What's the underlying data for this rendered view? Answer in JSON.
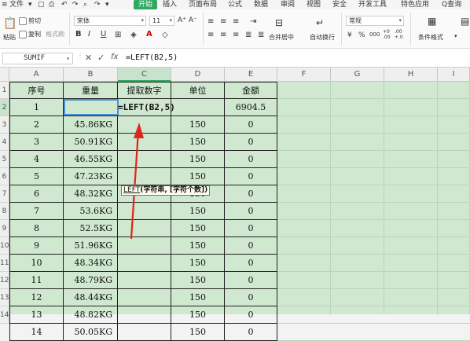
{
  "menu": {
    "file": "文件",
    "items": [
      "开始",
      "插入",
      "页面布局",
      "公式",
      "数据",
      "审阅",
      "视图",
      "安全",
      "开发工具",
      "特色应用"
    ],
    "search": "Q查询"
  },
  "ribbon": {
    "cut": "剪切",
    "paste": "粘贴",
    "copy": "复制",
    "format_painter": "格式刷",
    "font_name": "宋体",
    "font_size": "11",
    "bold": "B",
    "italic": "I",
    "underline": "U",
    "merge_center": "合并居中",
    "wrap_text": "自动换行",
    "number_format": "常规",
    "currency": "¥",
    "percent": "%",
    "thousands": "000",
    "dec_inc": "+0 .00",
    "dec_dec": ".00 +.0",
    "conditional_format": "条件格式"
  },
  "formula_bar": {
    "name_box": "SUMIF",
    "cancel": "✕",
    "confirm": "✓",
    "fx": "fx",
    "formula": "=LEFT(B2,5)"
  },
  "columns": [
    "A",
    "B",
    "C",
    "D",
    "E",
    "F",
    "G",
    "H",
    "I"
  ],
  "selected_column": "C",
  "rows": [
    "1",
    "2",
    "3",
    "4",
    "5",
    "6",
    "7",
    "8",
    "9",
    "10",
    "11",
    "12",
    "13",
    "14"
  ],
  "selected_row": "2",
  "table": {
    "headers": [
      "序号",
      "重量",
      "提取数字",
      "单位",
      "金额"
    ],
    "data": [
      [
        "1",
        "",
        "=LEFT(B2,5)",
        "",
        "6904.5"
      ],
      [
        "2",
        "45.86KG",
        "",
        "150",
        "0"
      ],
      [
        "3",
        "50.91KG",
        "",
        "150",
        "0"
      ],
      [
        "4",
        "46.55KG",
        "",
        "150",
        "0"
      ],
      [
        "5",
        "47.23KG",
        "",
        "150",
        "0"
      ],
      [
        "6",
        "48.32KG",
        "",
        "150",
        "0"
      ],
      [
        "7",
        "53.6KG",
        "",
        "150",
        "0"
      ],
      [
        "8",
        "52.5KG",
        "",
        "150",
        "0"
      ],
      [
        "9",
        "51.96KG",
        "",
        "150",
        "0"
      ],
      [
        "10",
        "48.34KG",
        "",
        "150",
        "0"
      ],
      [
        "11",
        "48.79KG",
        "",
        "150",
        "0"
      ],
      [
        "12",
        "48.44KG",
        "",
        "150",
        "0"
      ],
      [
        "13",
        "48.82KG",
        "",
        "150",
        "0"
      ],
      [
        "14",
        "50.05KG",
        "",
        "150",
        "0"
      ]
    ]
  },
  "tooltip": {
    "func": "LEFT",
    "args": "(字符串, [字符个数])"
  },
  "colors": {
    "accent": "#2fa860",
    "grid_bg": "#cfe8cf",
    "arrow": "#e0251b"
  }
}
